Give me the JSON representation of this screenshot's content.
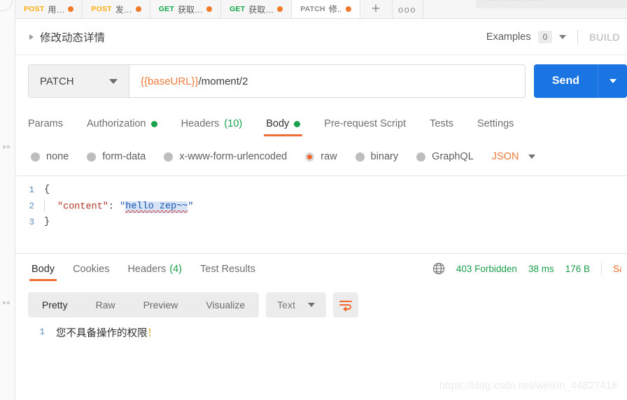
{
  "tabbar": {
    "tabs": [
      {
        "method": "POST",
        "method_class": "post",
        "name": "用…",
        "unsaved": true,
        "active": false
      },
      {
        "method": "POST",
        "method_class": "post",
        "name": "发…",
        "unsaved": true,
        "active": false
      },
      {
        "method": "GET",
        "method_class": "get",
        "name": "获取…",
        "unsaved": true,
        "active": false
      },
      {
        "method": "GET",
        "method_class": "get",
        "name": "获取…",
        "unsaved": true,
        "active": false
      },
      {
        "method": "PATCH",
        "method_class": "patch",
        "name": "修..",
        "unsaved": true,
        "active": true
      }
    ],
    "new_tab_label": "+",
    "more_label": "ooo",
    "ghost_field_text": "code:max_user"
  },
  "title_row": {
    "request_name": "修改动态详情",
    "examples_label": "Examples",
    "examples_count": "0",
    "build_label": "BUILD"
  },
  "url_bar": {
    "method": "PATCH",
    "url_variable": "{{baseURL}}",
    "url_path": "/moment/2",
    "send_label": "Send"
  },
  "request_tabs": [
    {
      "label": "Params",
      "active": false,
      "dot": false,
      "count": ""
    },
    {
      "label": "Authorization",
      "active": false,
      "dot": true,
      "count": ""
    },
    {
      "label": "Headers",
      "active": false,
      "dot": false,
      "count": "(10)"
    },
    {
      "label": "Body",
      "active": true,
      "dot": true,
      "count": ""
    },
    {
      "label": "Pre-request Script",
      "active": false,
      "dot": false,
      "count": ""
    },
    {
      "label": "Tests",
      "active": false,
      "dot": false,
      "count": ""
    },
    {
      "label": "Settings",
      "active": false,
      "dot": false,
      "count": ""
    }
  ],
  "body_types": {
    "options": [
      {
        "label": "none",
        "selected": false
      },
      {
        "label": "form-data",
        "selected": false
      },
      {
        "label": "x-www-form-urlencoded",
        "selected": false
      },
      {
        "label": "raw",
        "selected": true
      },
      {
        "label": "binary",
        "selected": false
      },
      {
        "label": "GraphQL",
        "selected": false
      }
    ],
    "format": "JSON"
  },
  "editor": {
    "line1_no": "1",
    "line1_text": "{",
    "line2_no": "2",
    "line2_key": "\"content\"",
    "line2_colon": ": ",
    "line2_quote_open": "\"",
    "line2_value": "hello zep~~",
    "line2_quote_close": "\"",
    "line3_no": "3",
    "line3_text": "}"
  },
  "response": {
    "tabs": [
      {
        "label": "Body",
        "active": true,
        "count": ""
      },
      {
        "label": "Cookies",
        "active": false,
        "count": ""
      },
      {
        "label": "Headers",
        "active": false,
        "count": "(4)"
      },
      {
        "label": "Test Results",
        "active": false,
        "count": ""
      }
    ],
    "status": "403 Forbidden",
    "time": "38 ms",
    "size": "176 B",
    "save_response_label": "Save Response",
    "view_modes": [
      {
        "label": "Pretty",
        "active": true
      },
      {
        "label": "Raw",
        "active": false
      },
      {
        "label": "Preview",
        "active": false
      },
      {
        "label": "Visualize",
        "active": false
      }
    ],
    "format": "Text",
    "body_line_no": "1",
    "body_text": "您不具备操作的权限",
    "body_bang": "！"
  },
  "watermark": "https://blog.csdn.net/weixin_44827418",
  "colors": {
    "accent_orange": "#ef6c34",
    "send_blue": "#1a74e2",
    "status_green": "#1b9e4b",
    "method_post": "#ffac0d",
    "method_get": "#13a64a"
  }
}
